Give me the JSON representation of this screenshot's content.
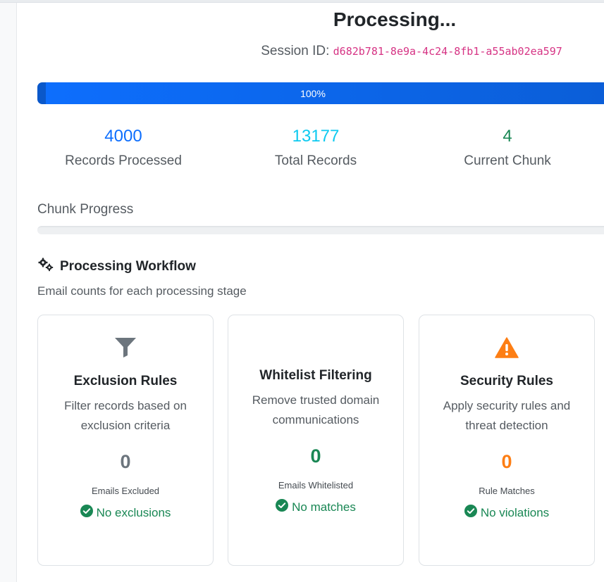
{
  "header": {
    "title": "Processing...",
    "session_label": "Session ID:",
    "session_id": "d682b781-8e9a-4c24-8fb1-a55ab02ea597"
  },
  "progress": {
    "label": "100%",
    "value": 1.0
  },
  "stats": [
    {
      "value": "4000",
      "label": "Records Processed",
      "color": "#0d6efd"
    },
    {
      "value": "13177",
      "label": "Total Records",
      "color": "#0dcaf0"
    },
    {
      "value": "4",
      "label": "Current Chunk",
      "color": "#198754"
    }
  ],
  "chunk": {
    "label": "Chunk Progress",
    "value": 0.0
  },
  "workflow": {
    "title": "Processing Workflow",
    "subtitle": "Email counts for each processing stage",
    "icon": "gears-icon",
    "cards": [
      {
        "icon": "filter-icon",
        "title": "Exclusion Rules",
        "description": "Filter records based on exclusion criteria",
        "count": "0",
        "count_label": "Emails Excluded",
        "status": "No exclusions",
        "count_color": "#6c757d"
      },
      {
        "icon": "",
        "title": "Whitelist Filtering",
        "description": "Remove trusted domain communications",
        "count": "0",
        "count_label": "Emails Whitelisted",
        "status": "No matches",
        "count_color": "#198754"
      },
      {
        "icon": "warning-icon",
        "title": "Security Rules",
        "description": "Apply security rules and threat detection",
        "count": "0",
        "count_label": "Rule Matches",
        "status": "No violations",
        "count_color": "#fd7e14"
      }
    ]
  },
  "colors": {
    "accent": "#0d6efd",
    "success": "#198754",
    "warning": "#fd7e14",
    "code": "#d63384"
  }
}
